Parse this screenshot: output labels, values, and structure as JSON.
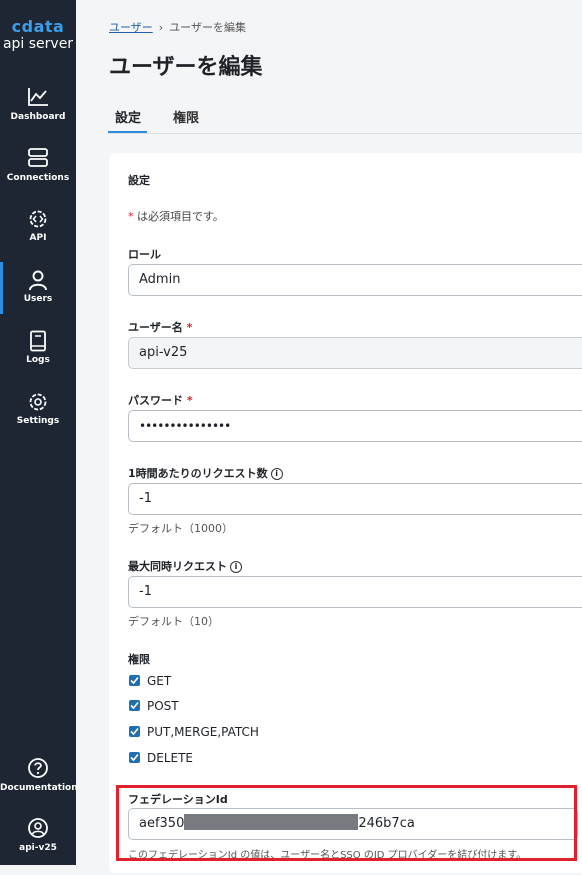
{
  "sidebar": {
    "logo_brand": "cdata",
    "logo_sub": "api server",
    "items": [
      {
        "label": "Dashboard",
        "icon": "chart-line-icon"
      },
      {
        "label": "Connections",
        "icon": "server-icon"
      },
      {
        "label": "API",
        "icon": "gear-code-icon"
      },
      {
        "label": "Users",
        "icon": "user-icon"
      },
      {
        "label": "Logs",
        "icon": "book-icon"
      },
      {
        "label": "Settings",
        "icon": "gear-icon"
      }
    ],
    "bottom": [
      {
        "label": "Documentation",
        "icon": "help-circle-icon"
      },
      {
        "label": "api-v25",
        "icon": "account-circle-icon"
      }
    ]
  },
  "breadcrumb": {
    "parent": "ユーザー",
    "current": "ユーザーを編集"
  },
  "page_title": "ユーザーを編集",
  "tabs": [
    {
      "label": "設定",
      "active": true
    },
    {
      "label": "権限",
      "active": false
    }
  ],
  "form": {
    "section_title": "設定",
    "required_mark": "*",
    "required_note": " は必須項目です。",
    "role": {
      "label": "ロール",
      "value": "Admin"
    },
    "username": {
      "label": "ユーザー名",
      "value": "api-v25"
    },
    "password": {
      "label": "パスワード",
      "value": "•••••••••••••••"
    },
    "requests_per_hour": {
      "label": "1時間あたりのリクエスト数",
      "value": "-1",
      "helper": "デフォルト（1000）"
    },
    "max_concurrent": {
      "label": "最大同時リクエスト",
      "value": "-1",
      "helper": "デフォルト（10）"
    },
    "permissions": {
      "label": "権限",
      "options": [
        {
          "label": "GET",
          "checked": true
        },
        {
          "label": "POST",
          "checked": true
        },
        {
          "label": "PUT,MERGE,PATCH",
          "checked": true
        },
        {
          "label": "DELETE",
          "checked": true
        }
      ]
    },
    "federation_id": {
      "label": "フェデレーションId",
      "value_prefix": "aef350",
      "value_suffix": "246b7ca",
      "helper": "このフェデレーションId の値は、ユーザー名とSSO のID プロバイダーを結び付けます。"
    }
  },
  "colors": {
    "sidebar_bg": "#1d2632",
    "accent": "#2f8ee0",
    "required": "#d9232d",
    "highlight": "#e0202c"
  }
}
